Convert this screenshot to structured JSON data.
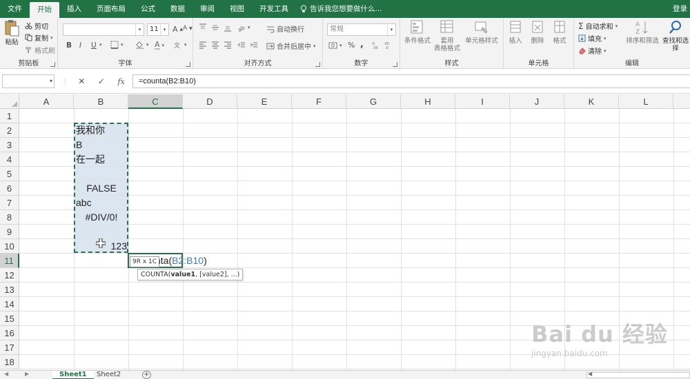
{
  "ribbon_tabs": [
    {
      "label": "文件"
    },
    {
      "label": "开始"
    },
    {
      "label": "插入"
    },
    {
      "label": "页面布局"
    },
    {
      "label": "公式"
    },
    {
      "label": "数据"
    },
    {
      "label": "审阅"
    },
    {
      "label": "视图"
    },
    {
      "label": "开发工具"
    }
  ],
  "active_tab": "开始",
  "tell_me": "告诉我您想要做什么...",
  "login": "登录",
  "clipboard": {
    "paste": "粘贴",
    "cut": "剪切",
    "copy": "复制",
    "format_painter": "格式刷",
    "label": "剪贴板"
  },
  "font": {
    "size": "11",
    "bold": "B",
    "italic": "I",
    "underline": "U",
    "font_color": "A",
    "label": "字体"
  },
  "alignment": {
    "wrap": "自动换行",
    "merge": "合并后居中",
    "label": "对齐方式"
  },
  "number": {
    "format": "常规",
    "percent": "%",
    "comma": ",",
    "label": "数字"
  },
  "styles": {
    "conditional": "条件格式",
    "table_1": "套用",
    "table_2": "表格格式",
    "cell_style": "单元格样式",
    "label": "样式"
  },
  "cells": {
    "insert": "插入",
    "delete": "删除",
    "format": "格式",
    "label": "单元格"
  },
  "editing": {
    "autosum": "自动求和",
    "fill": "填充",
    "clear": "清除",
    "sort": "排序和筛选",
    "find": "查找和选择",
    "label": "编辑"
  },
  "formula_bar": {
    "name_box": "",
    "cancel": "✕",
    "enter": "✓",
    "fx": "fx",
    "formula": "=counta(B2:B10)"
  },
  "columns": [
    "A",
    "B",
    "C",
    "D",
    "E",
    "F",
    "G",
    "H",
    "I",
    "J",
    "K",
    "L"
  ],
  "rows": [
    "1",
    "2",
    "3",
    "4",
    "5",
    "6",
    "7",
    "8",
    "9",
    "10",
    "11",
    "12",
    "13",
    "14",
    "15",
    "16",
    "17",
    "18"
  ],
  "cells_data": {
    "b2": "我和你",
    "b3": "B",
    "b4": "在一起",
    "b6": "FALSE",
    "b7": "abc",
    "b8": "#DIV/0!",
    "b10": "123"
  },
  "editing_cell": {
    "prefix": "nta(",
    "ref": "B2:B10",
    "suffix": ")"
  },
  "size_tip": "9R x 1C",
  "function_tip": {
    "name": "COUNTA(",
    "arg1": "value1",
    "rest": ", [value2], ...)"
  },
  "sheets": [
    {
      "label": "Sheet1"
    },
    {
      "label": "Sheet2"
    }
  ],
  "watermark": {
    "main": "Bai du 经验",
    "sub": "jingyan.baidu.com"
  },
  "colors": {
    "excel_green": "#217346",
    "selection_fill": "#dce6f1",
    "marquee": "#2e6f57",
    "reference_blue": "#3c7eb6"
  }
}
